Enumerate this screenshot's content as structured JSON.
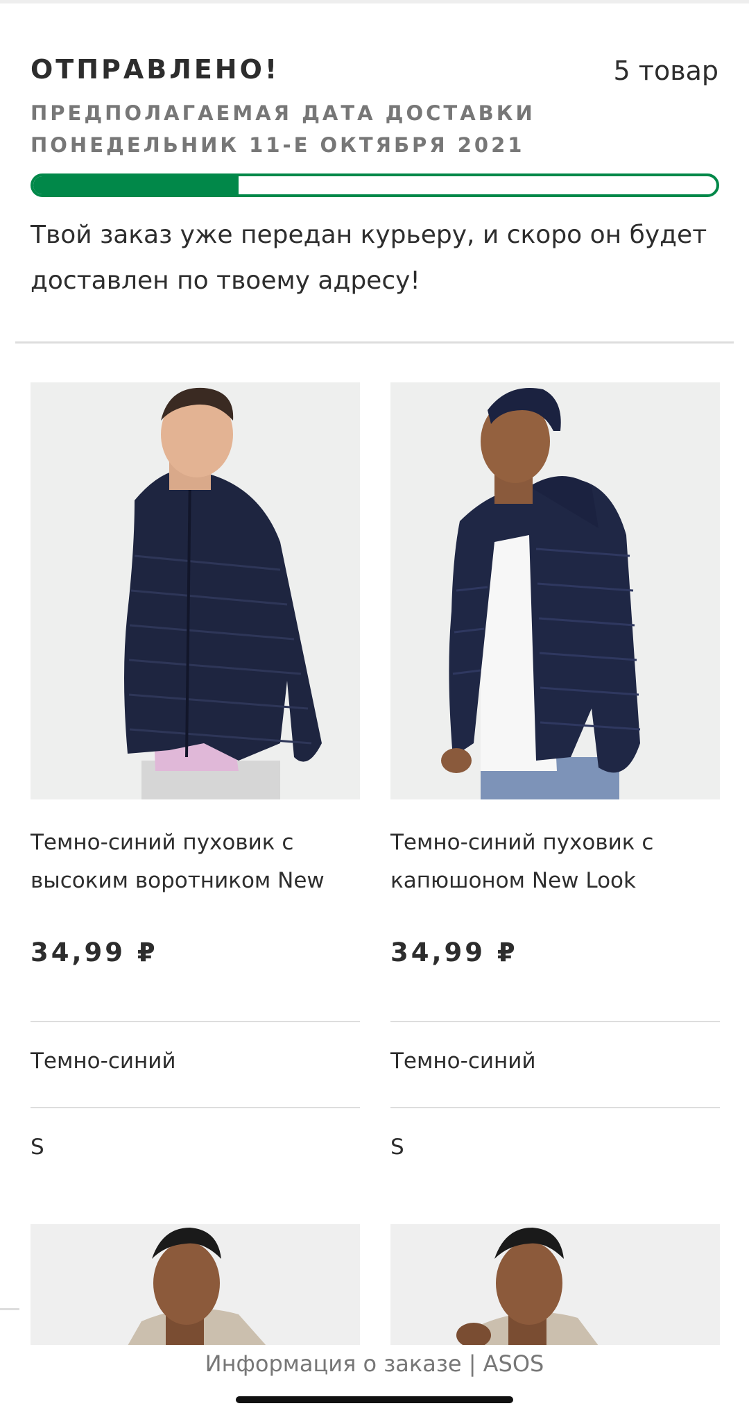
{
  "order_status": {
    "title": "ОТПРАВЛЕНО!",
    "item_count": "5 товар",
    "delivery_date": "ПРЕДПОЛАГАЕМАЯ ДАТА ДОСТАВКИ ПОНЕДЕЛЬНИК 11-Е ОКТЯБРЯ 2021",
    "progress_fraction": 0.3,
    "message": "Твой заказ уже передан курьеру, и скоро он будет доставлен по твоему адресу!",
    "accent_color": "#018849"
  },
  "items": [
    {
      "name": "Темно-синий пуховик с высоким воротником New",
      "price": "34,99 ₽",
      "color": "Темно-синий",
      "size": "S",
      "image": "product-photo-navy-puffer-high-neck"
    },
    {
      "name": "Темно-синий пуховик с капюшоном New Look",
      "price": "34,99 ₽",
      "color": "Темно-синий",
      "size": "S",
      "image": "product-photo-navy-puffer-hooded"
    }
  ],
  "more_items": [
    {
      "image": "product-photo-beige-jacket-1"
    },
    {
      "image": "product-photo-beige-jacket-2"
    }
  ],
  "footer": {
    "page_title": "Информация о заказе | ASOS"
  }
}
